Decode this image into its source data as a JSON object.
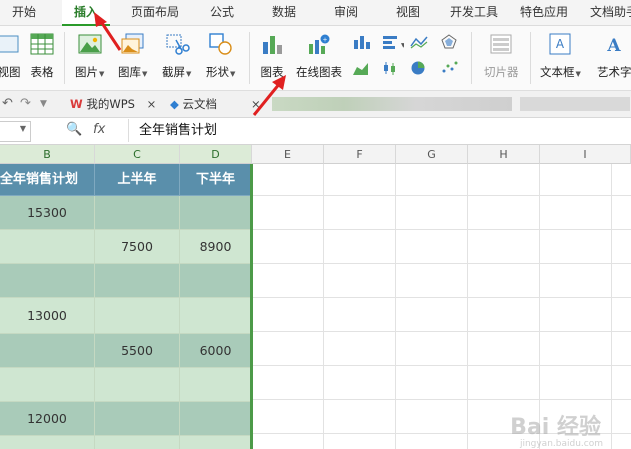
{
  "menu": {
    "tabs": [
      "开始",
      "插入",
      "页面布局",
      "公式",
      "数据",
      "审阅",
      "视图",
      "开发工具",
      "特色应用",
      "文档助手"
    ]
  },
  "ribbon": {
    "view_partial": "视图",
    "table": "表格",
    "picture": "图片",
    "gallery": "图库",
    "screenshot": "截屏",
    "shape": "形状",
    "chart": "图表",
    "online_chart": "在线图表",
    "slicer": "切片器",
    "textbox": "文本框",
    "wordart": "艺术字"
  },
  "docbar": {
    "my_wps": "我的WPS",
    "cloud_doc": "云文档"
  },
  "formula": {
    "fx": "fx",
    "value": "全年销售计划"
  },
  "columns": [
    "B",
    "C",
    "D",
    "E",
    "F",
    "G",
    "H",
    "I"
  ],
  "table": {
    "headers": [
      "全年销售计划",
      "上半年",
      "下半年"
    ],
    "rows": [
      [
        "15300",
        "",
        ""
      ],
      [
        "",
        "7500",
        "8900"
      ],
      [
        "",
        "",
        ""
      ],
      [
        "13000",
        "",
        ""
      ],
      [
        "",
        "5500",
        "6000"
      ],
      [
        "",
        "",
        ""
      ],
      [
        "12000",
        "",
        ""
      ],
      [
        "",
        "",
        ""
      ]
    ]
  },
  "watermark": {
    "brand": "Bai 经验",
    "url": "jingyan.baidu.com"
  },
  "colors": {
    "header_fill": "#5a8fab",
    "row_dark": "#a9cbb9",
    "row_light": "#cfe6d1",
    "accent": "#2a9a2a",
    "arrow": "#e02020"
  }
}
